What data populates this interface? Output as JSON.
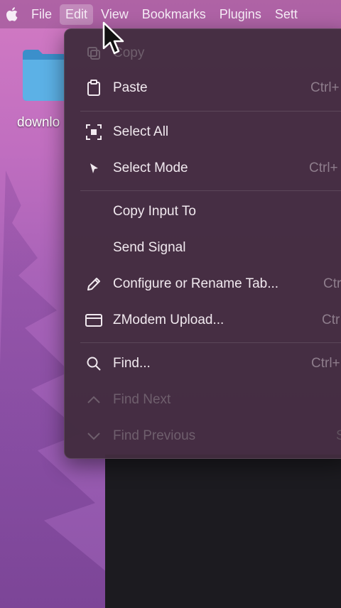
{
  "menubar": {
    "items": [
      {
        "label": "File"
      },
      {
        "label": "Edit"
      },
      {
        "label": "View"
      },
      {
        "label": "Bookmarks"
      },
      {
        "label": "Plugins"
      },
      {
        "label": "Sett"
      }
    ],
    "active": "Edit"
  },
  "desktop": {
    "folder_label": "downlo"
  },
  "edit_menu": {
    "items": [
      {
        "label": "Copy",
        "icon": "copy-icon",
        "disabled": true
      },
      {
        "label": "Paste",
        "icon": "clipboard-icon",
        "shortcut": "Ctrl+"
      },
      {
        "label": "Select All",
        "icon": "select-all-icon"
      },
      {
        "label": "Select Mode",
        "icon": "pointer-icon",
        "shortcut": "Ctrl+"
      },
      {
        "label": "Copy Input To"
      },
      {
        "label": "Send Signal"
      },
      {
        "label": "Configure or Rename Tab...",
        "icon": "pencil-icon",
        "shortcut": "Ctr"
      },
      {
        "label": "ZModem Upload...",
        "icon": "window-icon",
        "shortcut": "Ctr"
      },
      {
        "label": "Find...",
        "icon": "search-icon",
        "shortcut": "Ctrl+"
      },
      {
        "label": "Find Next",
        "icon": "chevron-up-icon",
        "disabled": true
      },
      {
        "label": "Find Previous",
        "icon": "chevron-down-icon",
        "shortcut": "S",
        "disabled": true
      }
    ]
  },
  "colors": {
    "menu_bg": "#422c3e",
    "menu_text": "#f1e9ef",
    "disabled_text": "#6f5f6d",
    "wallpaper": "#b45fae"
  }
}
